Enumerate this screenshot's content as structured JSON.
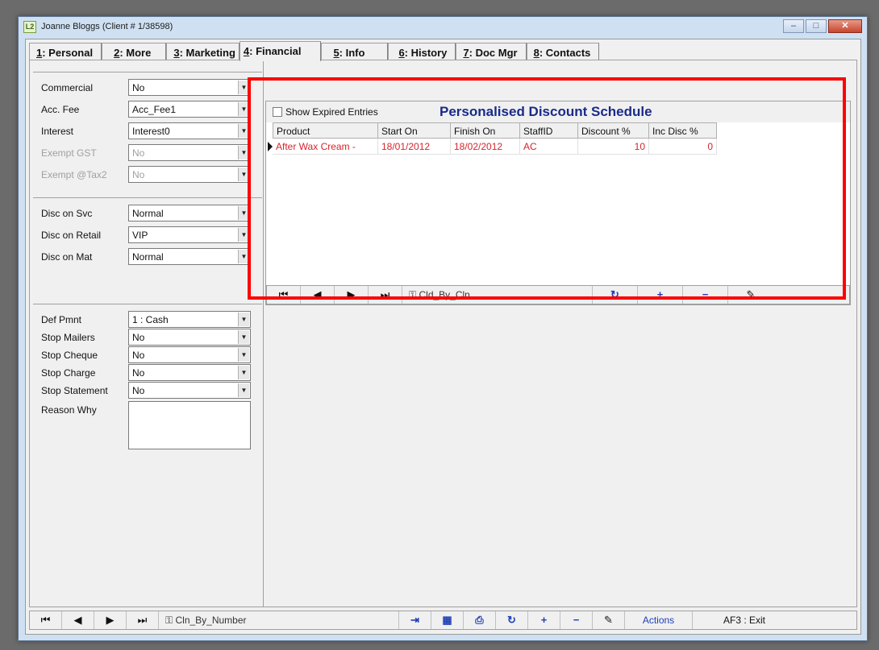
{
  "window": {
    "app_icon": "L2",
    "title": "Joanne Bloggs (Client # 1/38598)",
    "controls": [
      "minimize",
      "maximize",
      "close"
    ]
  },
  "tabs": [
    {
      "num": "1",
      "label": ": Personal"
    },
    {
      "num": "2",
      "label": ": More"
    },
    {
      "num": "3",
      "label": ": Marketing"
    },
    {
      "num": "4",
      "label": ": Financial"
    },
    {
      "num": "5",
      "label": ": Info"
    },
    {
      "num": "6",
      "label": ": History"
    },
    {
      "num": "7",
      "label": ": Doc Mgr"
    },
    {
      "num": "8",
      "label": ": Contacts"
    }
  ],
  "active_tab": "4",
  "fields_group1": [
    {
      "label": "Commercial",
      "value": "No",
      "disabled": false
    },
    {
      "label": "Acc. Fee",
      "value": "Acc_Fee1",
      "disabled": false
    },
    {
      "label": "Interest",
      "value": "Interest0",
      "disabled": false
    },
    {
      "label": "Exempt GST",
      "value": "No",
      "disabled": true
    },
    {
      "label": "Exempt @Tax2",
      "value": "No",
      "disabled": true
    }
  ],
  "fields_group2": [
    {
      "label": "Disc on Svc",
      "value": "Normal"
    },
    {
      "label": "Disc on Retail",
      "value": "VIP"
    },
    {
      "label": "Disc on Mat",
      "value": "Normal"
    }
  ],
  "fields_group3": [
    {
      "label": "Def Pmnt",
      "value": "1 : Cash"
    },
    {
      "label": "Stop Mailers",
      "value": "No"
    },
    {
      "label": "Stop Cheque",
      "value": "No"
    },
    {
      "label": "Stop Charge",
      "value": "No"
    },
    {
      "label": "Stop Statement",
      "value": "No"
    }
  ],
  "reason_why_label": "Reason Why",
  "discount": {
    "show_expired_label": "Show Expired Entries",
    "title": "Personalised Discount Schedule",
    "columns": [
      "Product",
      "Start On",
      "Finish On",
      "StaffID",
      "Discount %",
      "Inc Disc %"
    ],
    "rows": [
      [
        "After Wax Cream -",
        "18/01/2012",
        "18/02/2012",
        "AC",
        "10",
        "0"
      ]
    ],
    "index_label": "Cld_By_Cln"
  },
  "bottom_nav": {
    "index_label": "Cln_By_Number",
    "actions_label": "Actions",
    "exit_label": "AF3 : Exit"
  },
  "colors": {
    "highlight": "#ff0000",
    "grid_title": "#1a2a8a",
    "row_text": "#d8232a",
    "action_blue": "#1f3fb5"
  }
}
